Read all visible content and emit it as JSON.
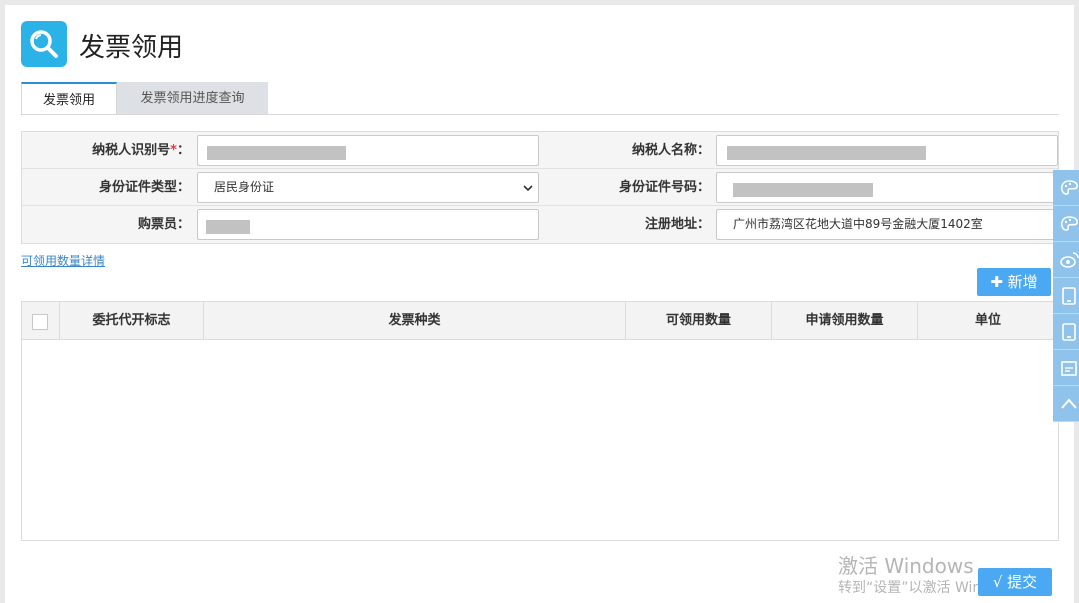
{
  "header": {
    "title": "发票领用"
  },
  "tabs": [
    {
      "label": "发票领用"
    },
    {
      "label": "发票领用进度查询"
    }
  ],
  "form": {
    "taxpayer_id_label": "纳税人识别号",
    "required_mark": "*",
    "label_colon": "：",
    "taxpayer_name_label": "纳税人名称：",
    "id_type_label": "身份证件类型：",
    "id_type_value": "居民身份证",
    "id_number_label": "身份证件号码：",
    "buyer_label": "购票员：",
    "address_label": "注册地址：",
    "address_value": "广州市荔湾区花地大道中89号金融大厦1402室"
  },
  "detail_link": "可领用数量详情",
  "add_button": "✚ 新增",
  "table": {
    "columns": [
      "委托代开标志",
      "发票种类",
      "可领用数量",
      "申请领用数量",
      "单位"
    ]
  },
  "submit_button": "√ 提交",
  "watermark": {
    "line1": "激活 Windows",
    "line2": "转到“设置”以激活 Windows。"
  },
  "colors": {
    "accent": "#2bb3e8",
    "button": "#4aa9f2",
    "tab_active_border": "#2a8fd6",
    "required": "#e23b3b",
    "link": "#3a86c8"
  },
  "icons": {
    "header": "search-icon",
    "float_bar": [
      "palette-icon",
      "palette-icon",
      "weibo-icon",
      "tablet-icon",
      "tablet-icon",
      "edit-icon",
      "chevron-up-icon"
    ]
  }
}
